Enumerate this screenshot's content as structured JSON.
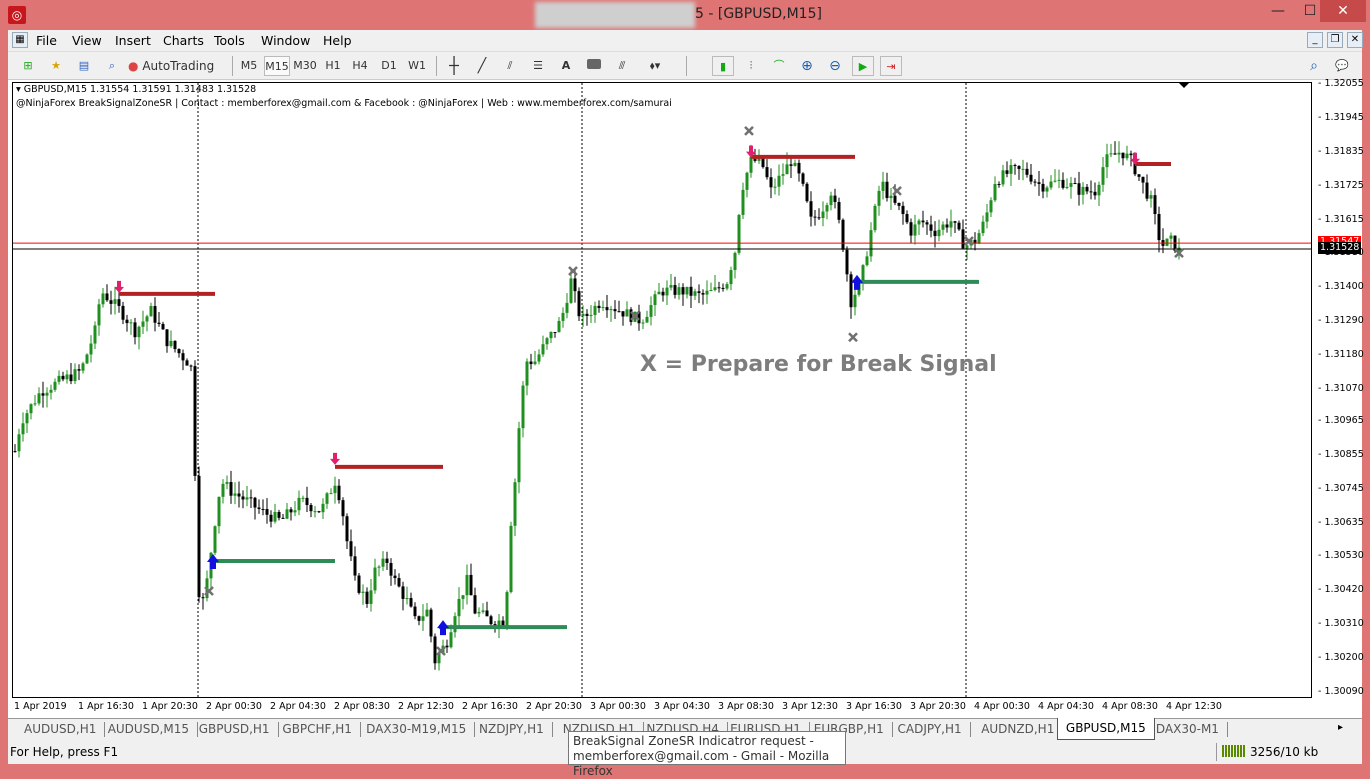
{
  "window": {
    "title": "5 - [GBPUSD,M15]",
    "minimize": "—",
    "maximize": "☐",
    "close": "✕"
  },
  "menu": [
    "File",
    "View",
    "Insert",
    "Charts",
    "Tools",
    "Window",
    "Help"
  ],
  "toolbar": {
    "autotrading": "AutoTrading",
    "timeframes": [
      "M5",
      "M15",
      "M30",
      "H1",
      "H4",
      "D1",
      "W1"
    ],
    "active_timeframe": "M15",
    "text_tool": "A"
  },
  "chart": {
    "info_line": "GBPUSD,M15  1.31554 1.31591 1.31483 1.31528",
    "indicator_line": "@NinjaForex BreakSignalZoneSR | Contact : memberforex@gmail.com & Facebook : @NinjaForex | Web : www.memberforex.com/samurai",
    "annotation": "X = Prepare for Break Signal",
    "bid_label": "1.31528",
    "ask_label": "1.31547",
    "price_labels": [
      "1.32055",
      "1.31945",
      "1.31835",
      "1.31725",
      "1.31615",
      "1.31510",
      "1.31400",
      "1.31290",
      "1.31180",
      "1.31070",
      "1.30965",
      "1.30855",
      "1.30745",
      "1.30635",
      "1.30530",
      "1.30420",
      "1.30310",
      "1.30200",
      "1.30090"
    ],
    "time_labels": [
      "1 Apr 2019",
      "1 Apr 16:30",
      "1 Apr 20:30",
      "2 Apr 00:30",
      "2 Apr 04:30",
      "2 Apr 08:30",
      "2 Apr 12:30",
      "2 Apr 16:30",
      "2 Apr 20:30",
      "3 Apr 00:30",
      "3 Apr 04:30",
      "3 Apr 08:30",
      "3 Apr 12:30",
      "3 Apr 16:30",
      "3 Apr 20:30",
      "4 Apr 00:30",
      "4 Apr 04:30",
      "4 Apr 08:30",
      "4 Apr 12:30"
    ],
    "colors": {
      "bull": "#1f8f1f",
      "bear": "#000000",
      "resistance": "#b22222",
      "support": "#2e8b57",
      "sell_arrow": "#e0206e",
      "buy_arrow": "#1010e0",
      "x_mark": "#707070",
      "ask_line": "#ff0000"
    }
  },
  "chart_data": {
    "type": "candlestick",
    "symbol": "GBPUSD",
    "timeframe": "M15",
    "ylim": [
      1.3009,
      1.32055
    ],
    "price_path_by_bar": [
      [
        0,
        1.30875
      ],
      [
        1.5,
        1.30972
      ],
      [
        6.5,
        1.31069
      ],
      [
        11.5,
        1.31102
      ],
      [
        16.5,
        1.31134
      ],
      [
        20,
        1.31263
      ],
      [
        21.5,
        1.31393
      ],
      [
        24,
        1.3136
      ],
      [
        26.5,
        1.31328
      ],
      [
        30,
        1.31263
      ],
      [
        34,
        1.31328
      ],
      [
        38,
        1.31231
      ],
      [
        43,
        1.31166
      ],
      [
        44.5,
        1.31134
      ],
      [
        45.5,
        1.30487
      ],
      [
        46.5,
        1.30358
      ],
      [
        48,
        1.30455
      ],
      [
        49,
        1.30552
      ],
      [
        50,
        1.30649
      ],
      [
        51.5,
        1.30778
      ],
      [
        54,
        1.30746
      ],
      [
        58,
        1.30714
      ],
      [
        61.5,
        1.30681
      ],
      [
        66.5,
        1.30649
      ],
      [
        71.5,
        1.30714
      ],
      [
        76.5,
        1.30681
      ],
      [
        80,
        1.30778
      ],
      [
        81.5,
        1.30714
      ],
      [
        83,
        1.30584
      ],
      [
        85,
        1.30455
      ],
      [
        88,
        1.3039
      ],
      [
        90,
        1.30487
      ],
      [
        93,
        1.3052
      ],
      [
        95,
        1.30455
      ],
      [
        98,
        1.3039
      ],
      [
        100,
        1.30326
      ],
      [
        103,
        1.30358
      ],
      [
        105,
        1.30197
      ],
      [
        108,
        1.30261
      ],
      [
        110,
        1.30358
      ],
      [
        113,
        1.30455
      ],
      [
        115,
        1.30358
      ],
      [
        119,
        1.30326
      ],
      [
        122.5,
        1.30326
      ],
      [
        124,
        1.30649
      ],
      [
        125,
        1.30778
      ],
      [
        126.5,
        1.31037
      ],
      [
        128,
        1.31166
      ],
      [
        130,
        1.31166
      ],
      [
        133,
        1.31231
      ],
      [
        136.5,
        1.31296
      ],
      [
        139,
        1.31425
      ],
      [
        141.5,
        1.31296
      ],
      [
        146.5,
        1.3136
      ],
      [
        151.5,
        1.31328
      ],
      [
        156.5,
        1.31296
      ],
      [
        161.5,
        1.31393
      ],
      [
        166.5,
        1.31393
      ],
      [
        171.5,
        1.31376
      ],
      [
        175,
        1.31393
      ],
      [
        178,
        1.31425
      ],
      [
        180,
        1.31522
      ],
      [
        181.5,
        1.31716
      ],
      [
        184,
        1.31813
      ],
      [
        186.5,
        1.31813
      ],
      [
        189,
        1.31716
      ],
      [
        194,
        1.31813
      ],
      [
        196.5,
        1.31748
      ],
      [
        199,
        1.31619
      ],
      [
        201.5,
        1.31651
      ],
      [
        204,
        1.31716
      ],
      [
        206.5,
        1.31586
      ],
      [
        209,
        1.3136
      ],
      [
        211.5,
        1.31425
      ],
      [
        214,
        1.31586
      ],
      [
        216.5,
        1.31748
      ],
      [
        219,
        1.31683
      ],
      [
        221.5,
        1.31651
      ],
      [
        224,
        1.31586
      ],
      [
        226.5,
        1.31619
      ],
      [
        230,
        1.31586
      ],
      [
        234,
        1.31619
      ],
      [
        237.5,
        1.31538
      ],
      [
        240,
        1.31554
      ],
      [
        242.5,
        1.31619
      ],
      [
        245,
        1.31748
      ],
      [
        249,
        1.3178
      ],
      [
        252.5,
        1.3178
      ],
      [
        256.5,
        1.31732
      ],
      [
        261.5,
        1.31748
      ],
      [
        266.5,
        1.31716
      ],
      [
        270,
        1.31716
      ],
      [
        272.5,
        1.31813
      ],
      [
        276.5,
        1.31845
      ],
      [
        279,
        1.31813
      ],
      [
        281.5,
        1.31748
      ],
      [
        284,
        1.31683
      ],
      [
        286.5,
        1.31538
      ],
      [
        289,
        1.31554
      ],
      [
        291,
        1.31522
      ]
    ],
    "zones": [
      {
        "type": "resistance",
        "price": 1.31383,
        "from_bar": 26,
        "to_bar": 50
      },
      {
        "type": "resistance",
        "price": 1.30824,
        "from_bar": 80,
        "to_bar": 107
      },
      {
        "type": "resistance",
        "price": 1.31826,
        "from_bar": 184,
        "to_bar": 210
      },
      {
        "type": "resistance",
        "price": 1.31803,
        "from_bar": 280,
        "to_bar": 289
      },
      {
        "type": "support",
        "price": 1.3052,
        "from_bar": 49,
        "to_bar": 80
      },
      {
        "type": "support",
        "price": 1.30306,
        "from_bar": 106,
        "to_bar": 138
      },
      {
        "type": "support",
        "price": 1.31422,
        "from_bar": 210,
        "to_bar": 241
      }
    ],
    "sell_signals": [
      [
        26,
        1.31393
      ],
      [
        80,
        1.30837
      ],
      [
        184,
        1.3183
      ],
      [
        280,
        1.31807
      ]
    ],
    "buy_signals": [
      [
        49.5,
        1.3052
      ],
      [
        107,
        1.30306
      ],
      [
        210.5,
        1.31422
      ]
    ],
    "prepare_marks": [
      [
        48.5,
        1.30423
      ],
      [
        139.5,
        1.31457
      ],
      [
        155,
        1.31312
      ],
      [
        183.5,
        1.3191
      ],
      [
        220.5,
        1.31716
      ],
      [
        106.5,
        1.30229
      ],
      [
        209.5,
        1.31243
      ],
      [
        238.5,
        1.31554
      ],
      [
        291,
        1.31515
      ]
    ],
    "day_separators_bar": [
      45.75,
      141.75,
      237.75
    ],
    "bid": 1.31528,
    "ask": 1.31547
  },
  "tabs": {
    "items": [
      "AUDUSD,H1",
      "AUDUSD,M15",
      "GBPUSD,H1",
      "GBPCHF,H1",
      "DAX30-M19,M15",
      "NZDJPY,H1",
      "NZDUSD,H1",
      "NZDUSD,H4",
      "EURUSD,H1",
      "EURGBP,H1",
      "CADJPY,H1",
      "AUDNZD,H1",
      "GBPUSD,M15",
      "DAX30-M1"
    ],
    "active": "GBPUSD,M15"
  },
  "status": {
    "help": "For Help, press F1",
    "traffic": "3256/10 kb"
  },
  "tooltip": {
    "line1": "BreakSignal ZoneSR Indicatror request -",
    "line2": "memberforex@gmail.com - Gmail - Mozilla Firefox"
  }
}
